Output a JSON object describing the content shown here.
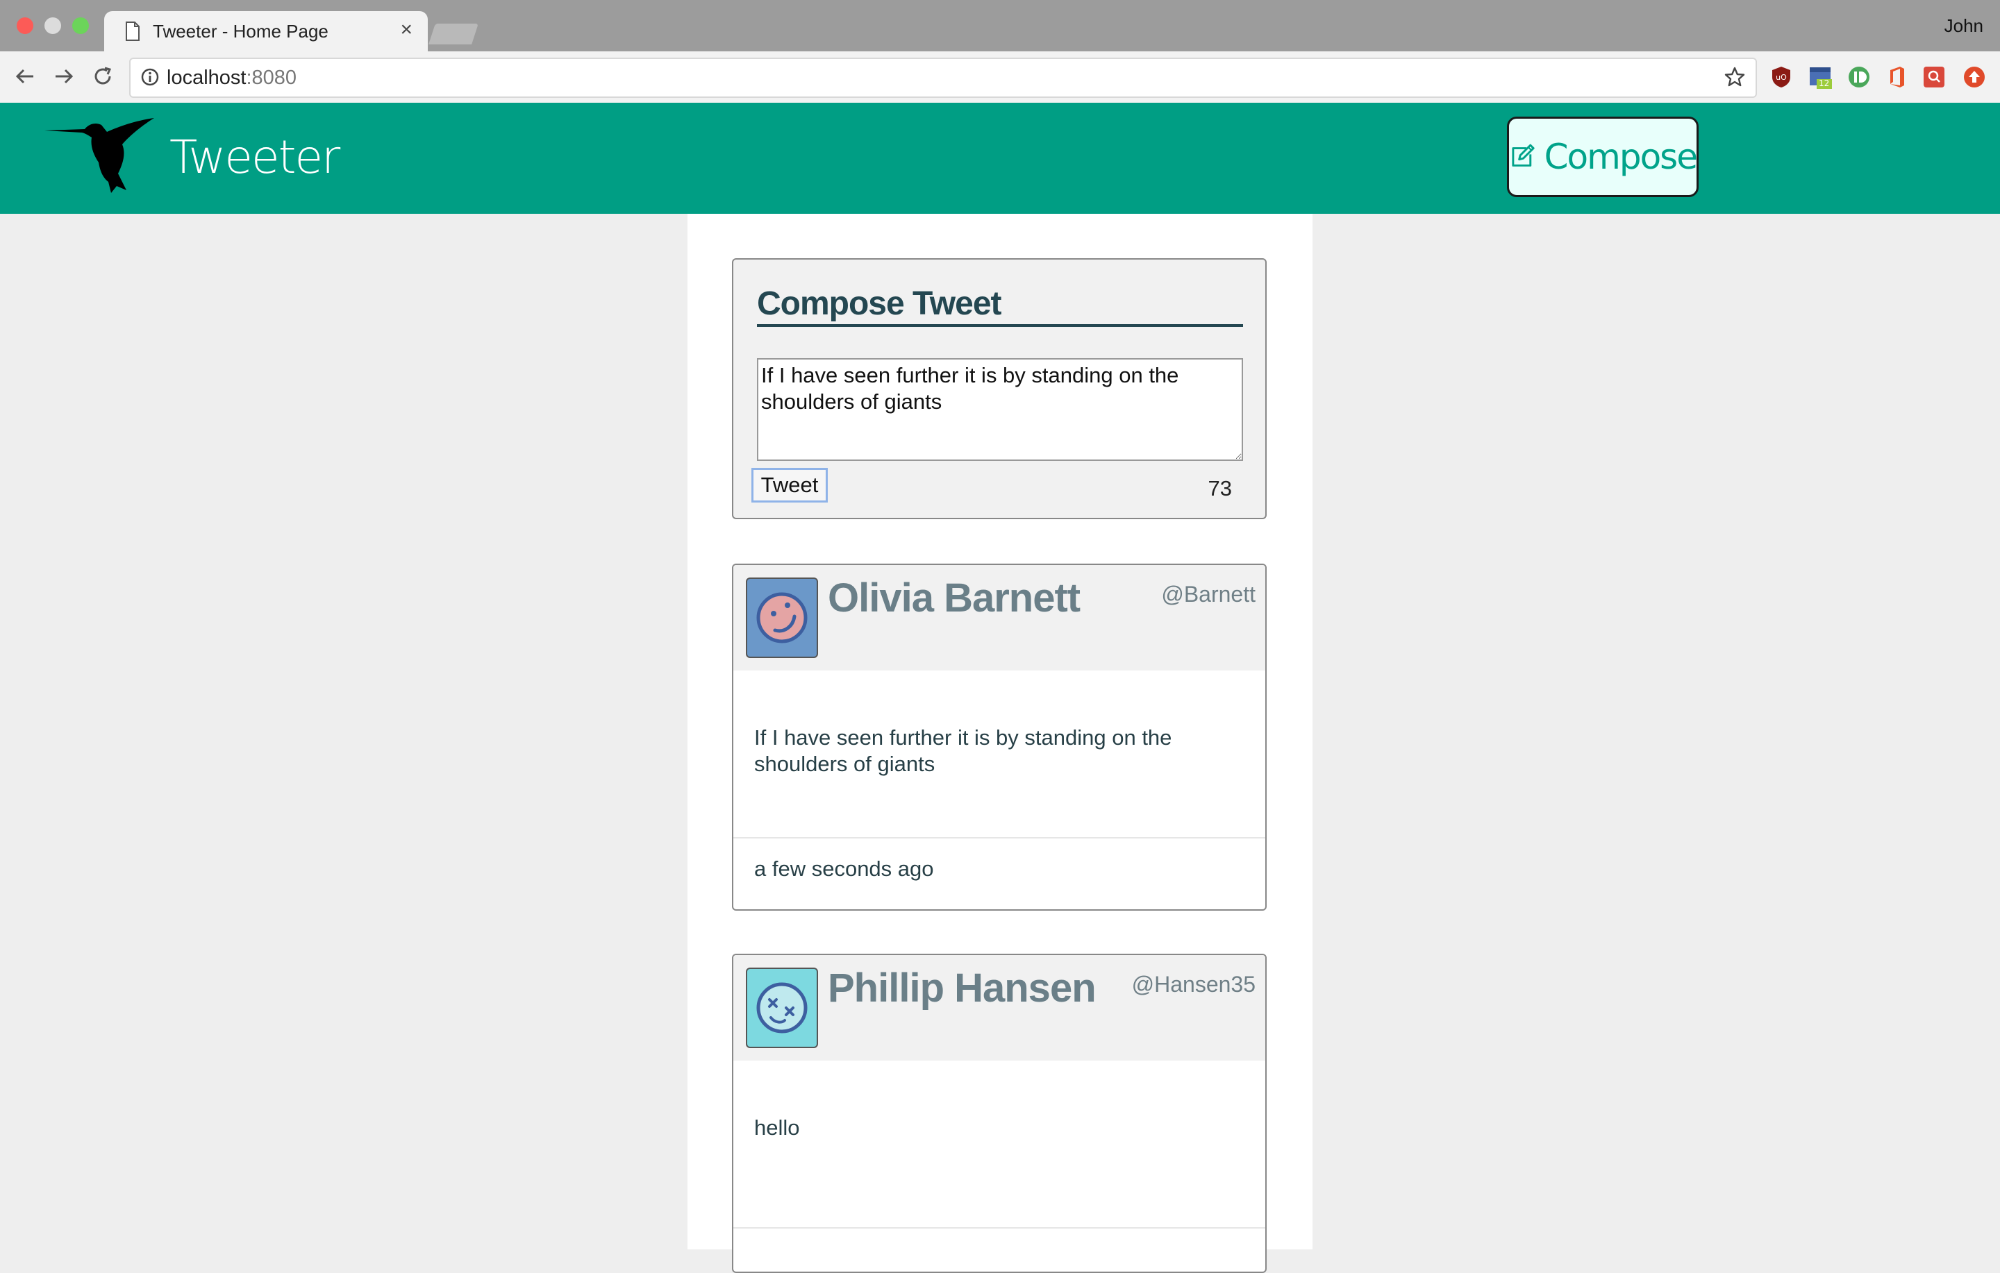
{
  "browser": {
    "tab_title": "Tweeter - Home Page",
    "tab_close": "×",
    "profile_name": "John",
    "url_host": "localhost",
    "url_port": ":8080",
    "extension_badge": "12"
  },
  "header": {
    "brand": "Tweeter",
    "compose_label": "Compose",
    "color": "#009e84"
  },
  "compose": {
    "title": "Compose Tweet",
    "text": "If I have seen further it is by standing on the shoulders of giants",
    "button_label": "Tweet",
    "counter": "73"
  },
  "tweets": [
    {
      "name": "Olivia Barnett",
      "handle": "@Barnett",
      "content": "If I have seen further it is by standing on the shoulders of giants",
      "time": "a few seconds ago",
      "avatar_color": "#6b98c9"
    },
    {
      "name": "Phillip Hansen",
      "handle": "@Hansen35",
      "content": "hello",
      "time": "",
      "avatar_color": "#7dd9e0"
    }
  ]
}
